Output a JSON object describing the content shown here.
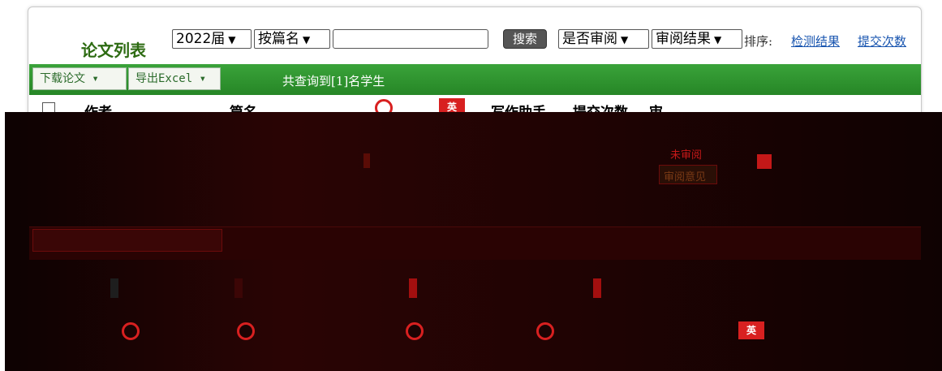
{
  "toolbar": {
    "title": "论文列表",
    "year_select": "2022届",
    "field_select": "按篇名",
    "search_value": "",
    "search_button": "搜索",
    "review_select": "是否审阅",
    "result_select": "审阅结果",
    "sort_label": "排序:",
    "sort_links": [
      "检测结果",
      "提交次数"
    ]
  },
  "actions": {
    "download_label": "下载论文 ▾",
    "export_label": "导出Excel ▾",
    "result_text": "共查询到[1]名学生"
  },
  "table": {
    "headers": [
      "作者",
      "篇名",
      "写作助手",
      "提交次数",
      "审"
    ],
    "en_icon_label": "英"
  },
  "status": {
    "unreviewed": "未审阅",
    "review_opinion": "审阅意见"
  },
  "colors": {
    "title": "#2d6b12",
    "green_bar": "#2f962f",
    "link": "#1a56b0",
    "band": "#1a0303",
    "icon_red": "#d82020"
  }
}
